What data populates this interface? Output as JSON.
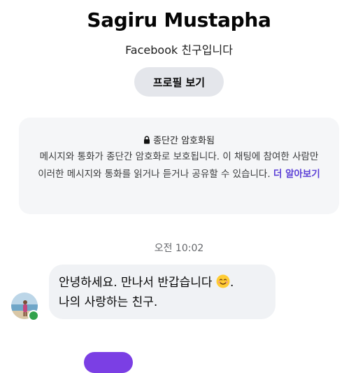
{
  "profile": {
    "name": "Sagiru Mustapha",
    "subtitle": "Facebook 친구입니다",
    "view_profile_label": "프로필 보기"
  },
  "encryption_notice": {
    "icon": "lock-icon",
    "title": "종단간 암호화됨",
    "body": "메시지와 통화가 종단간 암호화로 보호됩니다. 이 채팅에 참여한 사람만 이러한 메시지와 통화를 읽거나 듣거나 공유할 수 있습니다.",
    "learn_more_label": "더 알아보기",
    "link_color": "#5b3fd6"
  },
  "conversation": {
    "timestamp": "오전 10:02",
    "messages": [
      {
        "line1": "안녕하세요. 만나서 반갑습니다",
        "emoji": "smiling-face-emoji",
        "line1_end": ".",
        "line2": "나의 사랑하는 친구."
      }
    ],
    "online_status_color": "#31a24c"
  },
  "theme": {
    "bubble_color": "#f0f2f5",
    "button_color": "#e4e6eb",
    "outgoing_bubble_color": "#7b3fe4"
  }
}
